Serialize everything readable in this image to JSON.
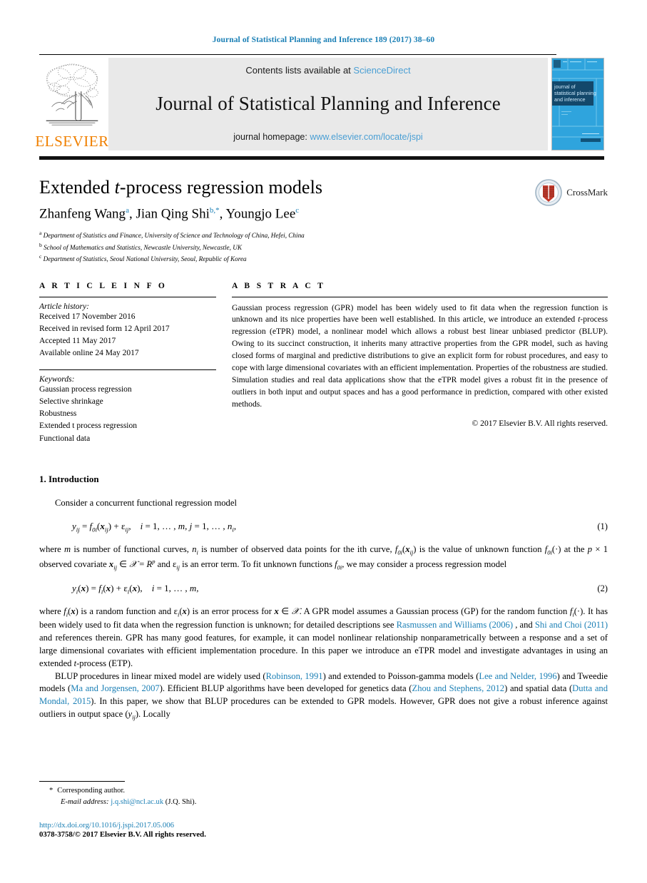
{
  "running_head": "Journal of Statistical Planning and Inference 189 (2017) 38–60",
  "masthead": {
    "contents_prefix": "Contents lists available at ",
    "sciencedirect": "ScienceDirect",
    "journal_title": "Journal of Statistical Planning and Inference",
    "homepage_prefix": "journal homepage: ",
    "homepage_url": "www.elsevier.com/locate/jspi",
    "publisher_wordmark": "ELSEVIER",
    "cover_title_lines": [
      "journal of",
      "statistical planning",
      "and inference"
    ],
    "link_color": "#4a9fd4",
    "panel_color": "#e9e9e9",
    "elsevier_orange": "#f08000",
    "cover_blue": "#2fa4dd"
  },
  "article": {
    "title_prefix": "Extended ",
    "title_italic": "t",
    "title_suffix": "-process regression models",
    "authors_plain_1": "Zhanfeng Wang",
    "authors_sup_1": "a",
    "authors_plain_2": ", Jian Qing Shi",
    "authors_sup_2": "b,*",
    "authors_plain_3": ", Youngjo Lee",
    "authors_sup_3": "c",
    "affiliations": [
      {
        "mark": "a",
        "text": "Department of Statistics and Finance, University of Science and Technology of China, Hefei, China"
      },
      {
        "mark": "b",
        "text": "School of Mathematics and Statistics, Newcastle University, Newcastle, UK"
      },
      {
        "mark": "c",
        "text": "Department of Statistics, Seoul National University, Seoul, Republic of Korea"
      }
    ],
    "crossmark_label": "CrossMark"
  },
  "article_info": {
    "heading": "A R T I C L E  I N F O",
    "history_label": "Article history:",
    "history": [
      "Received 17 November 2016",
      "Received in revised form 12 April 2017",
      "Accepted 11 May 2017",
      "Available online 24 May 2017"
    ],
    "keywords_label": "Keywords:",
    "keywords": [
      "Gaussian process regression",
      "Selective shrinkage",
      "Robustness",
      "Extended t process regression",
      "Functional data"
    ]
  },
  "abstract": {
    "heading": "A B S T R A C T",
    "body_1": "Gaussian process regression (GPR) model has been widely used to fit data when the regression function is unknown and its nice properties have been well established. In this article, we introduce an extended ",
    "body_italic": "t",
    "body_2": "-process regression (eTPR) model, a nonlinear model which allows a robust best linear unbiased predictor (BLUP). Owing to its succinct construction, it inherits many attractive properties from the GPR model, such as having closed forms of marginal and predictive distributions to give an explicit form for robust procedures, and easy to cope with large dimensional covariates with an efficient implementation. Properties of the robustness are studied. Simulation studies and real data applications show that the eTPR model gives a robust fit in the presence of outliers in both input and output spaces and has a good performance in prediction, compared with other existed methods.",
    "copyright": "© 2017 Elsevier B.V. All rights reserved."
  },
  "body": {
    "section_1_heading": "1. Introduction",
    "para_1": "Consider a concurrent functional regression model",
    "eq_1_number": "(1)",
    "eq_2_number": "(2)",
    "para_2_a": "where ",
    "para_2_b": " is number of functional curves, ",
    "para_2_c": " is number of observed data points for the ith curve, ",
    "para_2_d": " is the value of unknown function ",
    "para_2_e": " at the ",
    "para_2_f": " observed covariate ",
    "para_2_g": " and ",
    "para_2_h": " is an error term. To fit unknown functions ",
    "para_2_i": ", we may consider a process regression model",
    "para_3_a": "where ",
    "para_3_b": " is a random function and ",
    "para_3_c": " is an error process for ",
    "para_3_d": ". A GPR model assumes a Gaussian process (GP) for the random function ",
    "para_3_e": ". It has been widely used to fit data when the regression function is unknown; for detailed descriptions see ",
    "ref_rasmussen": "Rasmussen and Williams",
    "ref_rasmussen_year": "(2006)",
    "para_3_f": " , and ",
    "ref_shi": "Shi and Choi",
    "ref_shi_year": "(2011)",
    "para_3_g": " and references therein. GPR has many good features, for example, it can model nonlinear relationship nonparametrically between a response and a set of large dimensional covariates with efficient implementation procedure. In this paper we introduce an eTPR model and investigate advantages in using an extended ",
    "para_3_h": "-process (ETP).",
    "para_4_a": "BLUP procedures in linear mixed model are widely used (",
    "ref_robinson": "Robinson, 1991",
    "para_4_b": ") and extended to Poisson-gamma models (",
    "ref_lee_nelder": "Lee and Nelder, 1996",
    "para_4_c": ") and Tweedie models (",
    "ref_ma": "Ma and Jorgensen, 2007",
    "para_4_d": "). Efficient BLUP algorithms have been developed for genetics data (",
    "ref_zhou": "Zhou and Stephens, 2012",
    "para_4_e": ") and spatial data (",
    "ref_dutta": "Dutta and Mondal, 2015",
    "para_4_f": "). In this paper, we show that BLUP procedures can be extended to GPR models. However, GPR does not give a robust inference against outliers in output space (",
    "para_4_g": "). Locally"
  },
  "footer": {
    "corresponding_star": "*",
    "corresponding_label": "Corresponding author.",
    "email_label": "E-mail address:",
    "email_value": "j.q.shi@ncl.ac.uk",
    "email_owner": "(J.Q. Shi).",
    "doi": "http://dx.doi.org/10.1016/j.jspi.2017.05.006",
    "issn_line": "0378-3758/© 2017 Elsevier B.V. All rights reserved."
  },
  "colors": {
    "link_blue": "#1a7fb5",
    "sd_blue": "#4a9fd4",
    "orange": "#f08000"
  }
}
